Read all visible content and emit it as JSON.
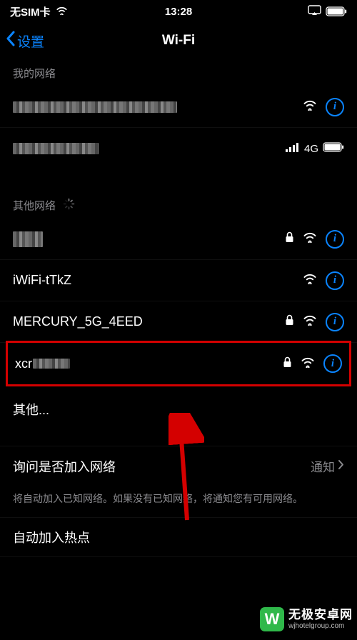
{
  "status": {
    "carrier": "无SIM卡",
    "time": "13:28"
  },
  "nav": {
    "back": "设置",
    "title": "Wi-Fi"
  },
  "sections": {
    "my_networks": "我的网络",
    "other_networks": "其他网络"
  },
  "networks": {
    "cell_label": "4G",
    "other": [
      {
        "name": "",
        "locked": true
      },
      {
        "name": "iWiFi-tTkZ",
        "locked": false
      },
      {
        "name": "MERCURY_5G_4EED",
        "locked": true
      },
      {
        "name": "xcr",
        "locked": true
      }
    ],
    "other_item": "其他..."
  },
  "settings": {
    "ask_join": "询问是否加入网络",
    "ask_join_value": "通知",
    "ask_join_note": "将自动加入已知网络。如果没有已知网络，将通知您有可用网络。",
    "auto_hotspot": "自动加入热点"
  },
  "watermark": {
    "brand": "无极安卓网",
    "url": "wjhotelgroup.com"
  }
}
